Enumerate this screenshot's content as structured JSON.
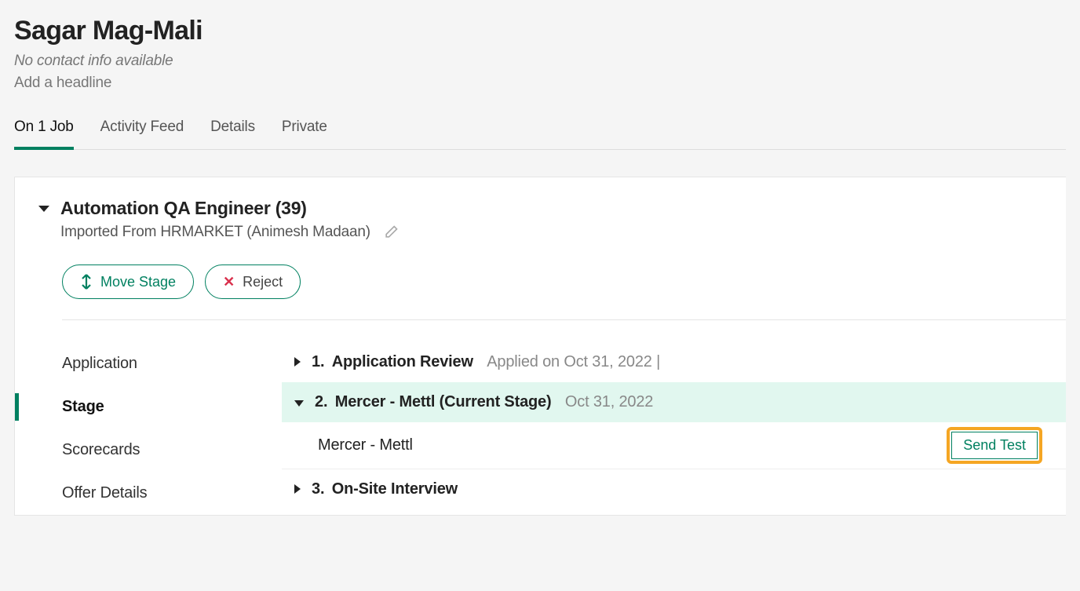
{
  "candidate": {
    "name": "Sagar Mag-Mali",
    "contact": "No contact info available",
    "headline": "Add a headline"
  },
  "tabs": {
    "on_job": "On 1 Job",
    "activity": "Activity Feed",
    "details": "Details",
    "private": "Private"
  },
  "job": {
    "title": "Automation QA Engineer (39)",
    "source": "Imported From HRMARKET (Animesh Madaan)"
  },
  "actions": {
    "move_stage": "Move Stage",
    "reject": "Reject"
  },
  "side_nav": {
    "application": "Application",
    "stage": "Stage",
    "scorecards": "Scorecards",
    "offer_details": "Offer Details"
  },
  "stages": {
    "s1": {
      "num": "1.",
      "label": "Application Review",
      "meta": "Applied on Oct 31, 2022 |"
    },
    "s2": {
      "num": "2.",
      "label": "Mercer - Mettl (Current Stage)",
      "meta": "Oct 31, 2022"
    },
    "s2_sub": {
      "label": "Mercer - Mettl",
      "button": "Send Test"
    },
    "s3": {
      "num": "3.",
      "label": "On-Site Interview"
    }
  }
}
